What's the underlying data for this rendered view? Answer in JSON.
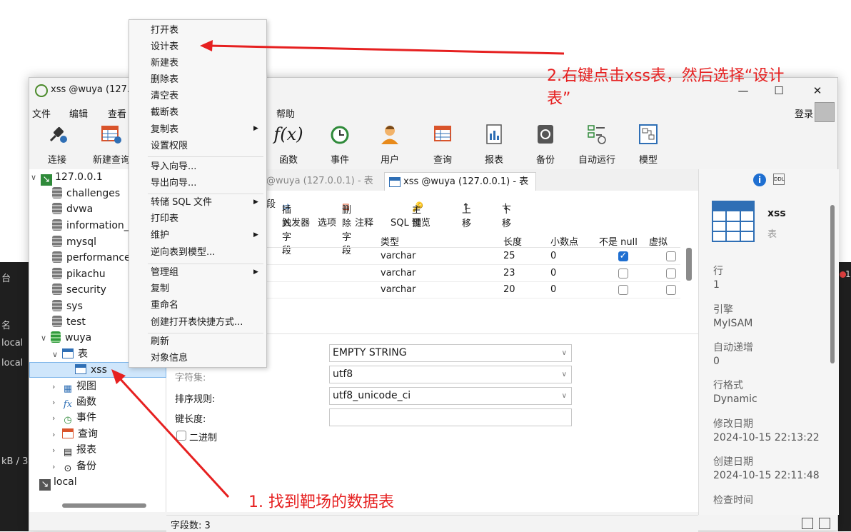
{
  "background_app": {
    "left_texts": [
      "台",
      "名",
      "local",
      "local",
      "kB / 3"
    ],
    "right_text": "1"
  },
  "window": {
    "title": "xss @wuya (127.0.0.1)",
    "login": "登录"
  },
  "menu": [
    "文件",
    "编辑",
    "查看",
    "帮助"
  ],
  "toolbar": [
    {
      "label": "连接",
      "icon": "plug-icon"
    },
    {
      "label": "新建查询",
      "icon": "new-query-icon"
    },
    {
      "label": "函数",
      "icon": "function-icon"
    },
    {
      "label": "事件",
      "icon": "clock-icon"
    },
    {
      "label": "用户",
      "icon": "user-icon"
    },
    {
      "label": "查询",
      "icon": "query-icon"
    },
    {
      "label": "报表",
      "icon": "report-icon"
    },
    {
      "label": "备份",
      "icon": "backup-icon"
    },
    {
      "label": "自动运行",
      "icon": "autorun-icon"
    },
    {
      "label": "模型",
      "icon": "model-icon"
    }
  ],
  "tree": {
    "root": "127.0.0.1",
    "databases": [
      "challenges",
      "dvwa",
      "information_",
      "mysql",
      "performance",
      "pikachu",
      "security",
      "sys",
      "test",
      "wuya"
    ],
    "tables_folder": "表",
    "selected_table": "xss",
    "folders": [
      "视图",
      "函数",
      "事件",
      "查询",
      "报表",
      "备份"
    ],
    "other_connection": "local"
  },
  "tabs": {
    "inactive": "@wuya (127.0.0.1) - 表",
    "active": "xss @wuya (127.0.0.1) - 表"
  },
  "content_toolbar": {
    "field": "段",
    "insert": "插入字段",
    "delete": "删除字段",
    "primary": "主键",
    "up": "上移",
    "down": "下移"
  },
  "subtabs": [
    "触发器",
    "选项",
    "注释",
    "SQL 预览"
  ],
  "grid": {
    "headers": [
      "类型",
      "长度",
      "小数点",
      "不是 null",
      "虚拟"
    ],
    "rows": [
      {
        "type": "varchar",
        "length": "25",
        "decimals": "0",
        "not_null": true,
        "virtual": false
      },
      {
        "type": "varchar",
        "length": "23",
        "decimals": "0",
        "not_null": false,
        "virtual": false
      },
      {
        "type": "varchar",
        "length": "20",
        "decimals": "0",
        "not_null": false,
        "virtual": false
      }
    ]
  },
  "options": {
    "default_value": "EMPTY STRING",
    "charset_label": "字符集:",
    "charset": "utf8",
    "collation_label": "排序规则:",
    "collation": "utf8_unicode_ci",
    "key_length_label": "键长度:",
    "binary_label": "二进制"
  },
  "status": {
    "field_count": "字段数: 3"
  },
  "info": {
    "object_name": "xss",
    "object_type": "表",
    "rows_label": "行",
    "rows": "1",
    "engine_label": "引擎",
    "engine": "MyISAM",
    "auto_inc_label": "自动递增",
    "auto_inc": "0",
    "row_format_label": "行格式",
    "row_format": "Dynamic",
    "modified_label": "修改日期",
    "modified": "2024-10-15 22:13:22",
    "created_label": "创建日期",
    "created": "2024-10-15 22:11:48",
    "check_label": "检查时间"
  },
  "context_menu": {
    "groups": [
      [
        "打开表",
        "设计表",
        "新建表",
        "删除表",
        "清空表",
        "截断表",
        "复制表",
        "设置权限"
      ],
      [
        "导入向导...",
        "导出向导..."
      ],
      [
        "转储 SQL 文件",
        "打印表",
        "维护",
        "逆向表到模型..."
      ],
      [
        "管理组",
        "复制",
        "重命名",
        "创建打开表快捷方式..."
      ],
      [
        "刷新",
        "对象信息"
      ]
    ]
  },
  "annotations": {
    "step2_line1": "2.右键点击xss表，然后选择“设计",
    "step2_line2": "表”",
    "step1": "1. 找到靶场的数据表",
    "color": "#e62020"
  }
}
